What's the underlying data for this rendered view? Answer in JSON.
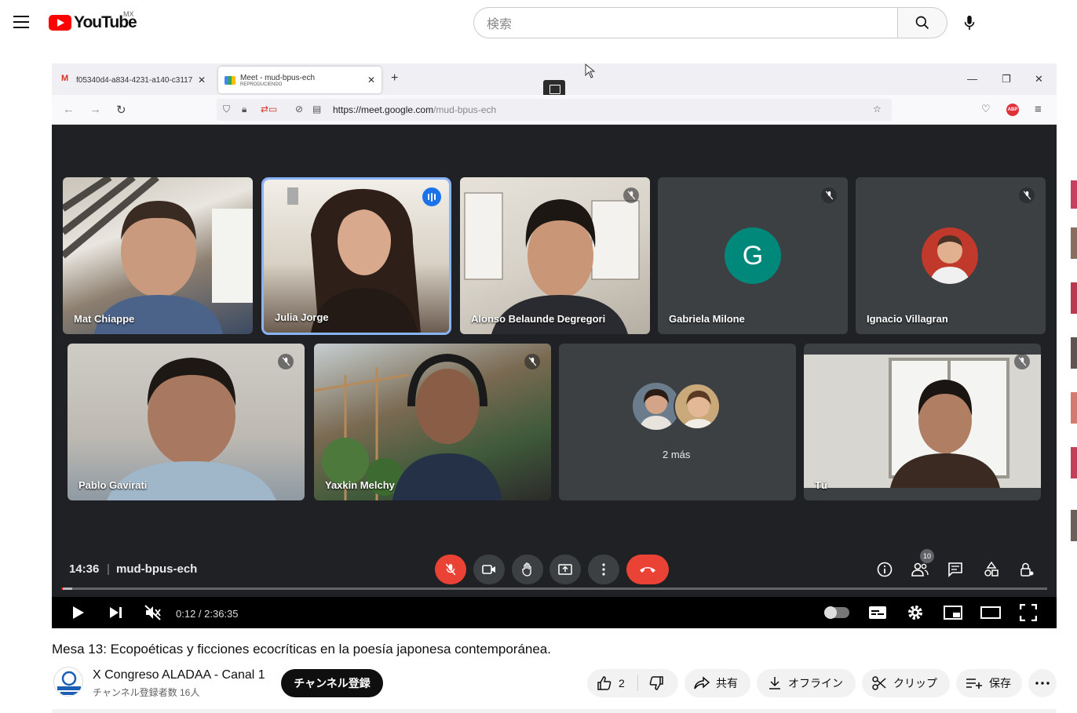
{
  "youtube": {
    "logo_text": "YouTube",
    "country": "MX",
    "search_placeholder": "検索"
  },
  "browser": {
    "tab1_title": "f05340d4-a834-4231-a140-c3117",
    "tab2_title": "Meet - mud-bpus-ech",
    "tab2_subtitle": "REPRODUCIENDO",
    "url_domain": "https://meet.google.com",
    "url_path": "/mud-bpus-ech"
  },
  "meet": {
    "participants": [
      {
        "name": "Mat Chiappe"
      },
      {
        "name": "Julia Jorge"
      },
      {
        "name": "Alonso Belaunde Degregori"
      },
      {
        "name": "Gabriela Milone",
        "initial": "G"
      },
      {
        "name": "Ignacio Villagran"
      },
      {
        "name": "Pablo Gavirati"
      },
      {
        "name": "Yaxkin Melchy"
      },
      {
        "name": "2 más"
      },
      {
        "name": "Tú"
      }
    ],
    "time": "14:36",
    "separator": "|",
    "meeting_code": "mud-bpus-ech",
    "people_count": "10"
  },
  "player": {
    "time_display": "0:12 / 2:36:35",
    "progress": 0.0013
  },
  "video": {
    "title": "Mesa 13: Ecopoéticas y ficciones ecocríticas en la poesía japonesa contemporánea.",
    "channel_name": "X Congreso ALADAA - Canal 1",
    "subscribers": "チャンネル登録者数 16人",
    "subscribe_label": "チャンネル登録",
    "likes": "2",
    "share_label": "共有",
    "download_label": "オフライン",
    "clip_label": "クリップ",
    "save_label": "保存"
  },
  "colors": {
    "brand_red": "#ff0000",
    "meet_bg": "#202124",
    "active_outline": "#8ab4f8",
    "mute_red": "#ea4335"
  }
}
